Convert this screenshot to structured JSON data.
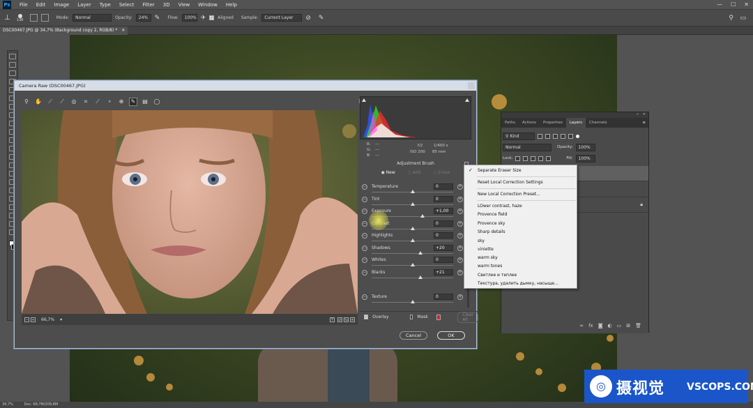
{
  "menubar": {
    "logo": "Ps",
    "items": [
      "File",
      "Edit",
      "Image",
      "Layer",
      "Type",
      "Select",
      "Filter",
      "3D",
      "View",
      "Window",
      "Help"
    ]
  },
  "optionsbar": {
    "brush_size": "136",
    "mode_label": "Mode:",
    "mode_value": "Normal",
    "opacity_label": "Opacity:",
    "opacity_value": "24%",
    "flow_label": "Flow:",
    "flow_value": "100%",
    "aligned_label": "Aligned",
    "sample_label": "Sample:",
    "sample_value": "Current Layer"
  },
  "document": {
    "tab_title": "DSC00467.JPG @ 34,7% (Background copy 2, RGB/8) *"
  },
  "statusbar": {
    "zoom": "34,7%",
    "doc_info": "Doc: 68,7M/209,8M"
  },
  "camera_raw": {
    "title": "Camera Raw (DSC00467.JPG)",
    "zoom": "66,7%",
    "readout": {
      "r_label": "R:",
      "g_label": "G:",
      "b_label": "B:",
      "r": "---",
      "g": "---",
      "b": "---",
      "aperture": "f/2",
      "shutter": "1/400 s",
      "iso": "ISO 200",
      "focal": "85 mm"
    },
    "panel_title": "Adjustment Brush",
    "modes": [
      "New",
      "Add",
      "Erase"
    ],
    "sliders": [
      {
        "label": "Temperature",
        "value": "0",
        "pos": 0.5
      },
      {
        "label": "Tint",
        "value": "0",
        "pos": 0.5
      },
      {
        "label": "Exposure",
        "value": "+1,00",
        "pos": 0.62
      },
      {
        "label": "Contrast",
        "value": "0",
        "pos": 0.5
      },
      {
        "label": "Highlights",
        "value": "0",
        "pos": 0.5
      },
      {
        "label": "Shadows",
        "value": "+20",
        "pos": 0.6
      },
      {
        "label": "Whites",
        "value": "0",
        "pos": 0.5
      },
      {
        "label": "Blacks",
        "value": "+21",
        "pos": 0.6
      }
    ],
    "texture": {
      "label": "Texture",
      "value": "0",
      "pos": 0.5
    },
    "overlay_label": "Overlay",
    "mask_label": "Mask",
    "mask_color": "#e02020",
    "clear_all_label": "Clear All",
    "cancel_label": "Cancel",
    "ok_label": "OK"
  },
  "context_menu": {
    "checked_item": "Separate Eraser Size",
    "item_reset": "Reset Local Correction Settings",
    "item_new_preset": "New Local Correction Preset...",
    "presets": [
      "LOwer contrast, haze",
      "Provence field",
      "Provence sky",
      "Sharp details",
      "sky",
      "viniette",
      "warm sky",
      "warm tones",
      "Светлее и теплее",
      "Текстура, удалить дымку, насыще..."
    ]
  },
  "layers_panel": {
    "tabs": [
      "Paths",
      "Actions",
      "Properties",
      "Layers",
      "Channels"
    ],
    "active_tab": "Layers",
    "kind_label": "Kind",
    "blend_mode": "Normal",
    "opacity_label": "Opacity:",
    "opacity_value": "100%",
    "lock_label": "Lock:",
    "fill_label": "Fill:",
    "fill_value": "100%"
  },
  "watermark": {
    "cn": "摄视觉",
    "en": "VSCOPS.COM",
    "logo_glyph": "◎"
  }
}
